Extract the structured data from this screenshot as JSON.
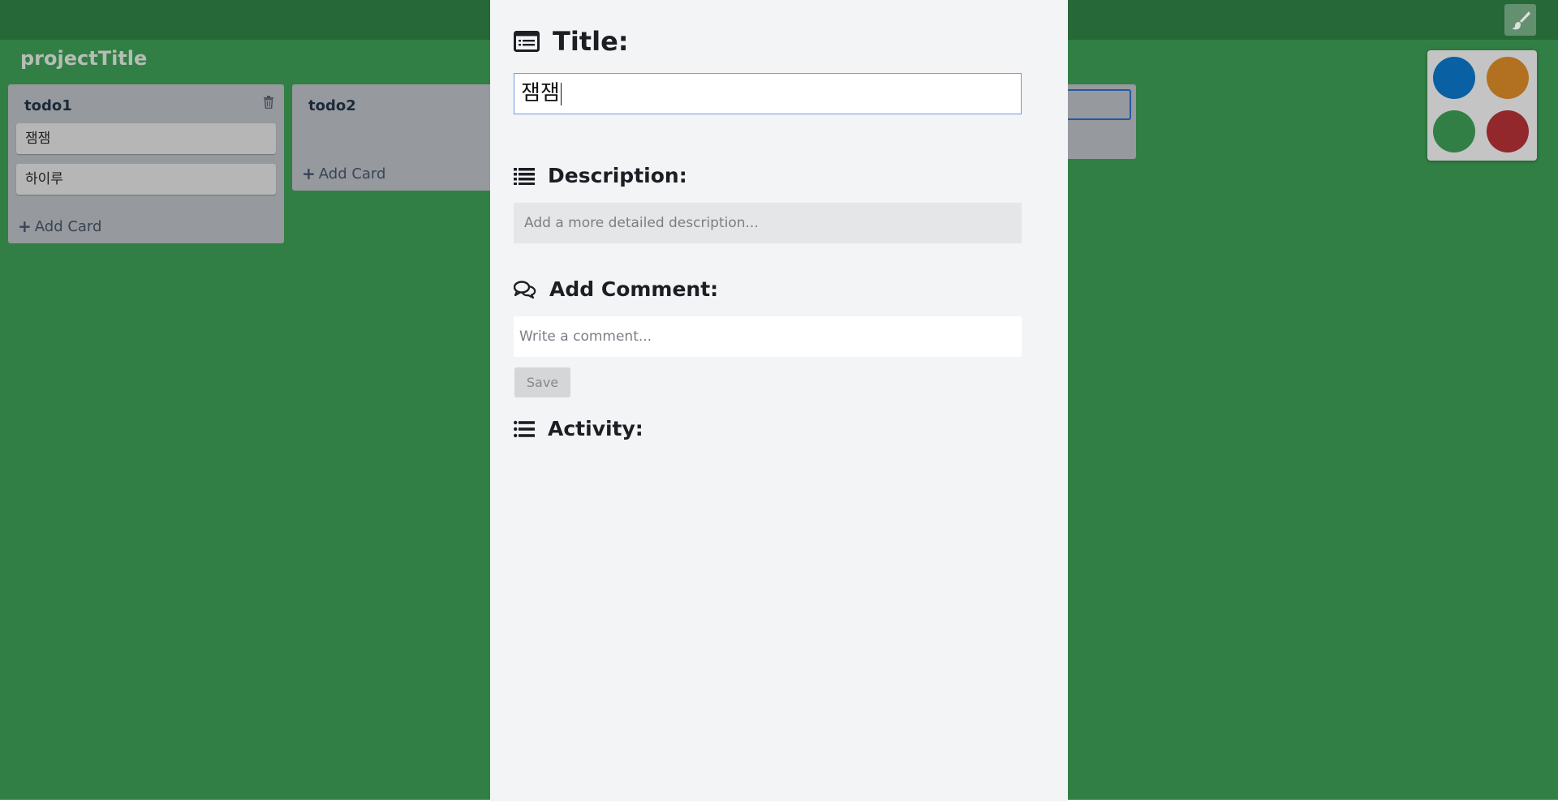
{
  "board": {
    "project_title": "projectTitle",
    "lists": [
      {
        "title": "todo1",
        "cards": [
          "잼잼",
          "하이루"
        ],
        "add_card_label": "Add Card"
      },
      {
        "title": "todo2",
        "cards": [],
        "add_card_label": "Add Card"
      }
    ]
  },
  "palette": {
    "colors": [
      "#0a68b0",
      "#bf7a24",
      "#35894a",
      "#9e2a30"
    ]
  },
  "modal": {
    "title_label": "Title:",
    "title_value": "잼잼",
    "description_label": "Description:",
    "description_placeholder": "Add a more detailed description...",
    "comment_label": "Add Comment:",
    "comment_placeholder": "Write a comment...",
    "save_label": "Save",
    "activity_label": "Activity:"
  },
  "colors": {
    "board_bg": "#35894a",
    "topbar_bg": "#2b703d",
    "modal_bg": "#f3f4f6"
  },
  "icons": {
    "brush": "paint-brush-icon",
    "trash": "trash-icon",
    "title": "credit-card-icon",
    "description": "list-icon",
    "comment": "comments-icon",
    "activity": "list-icon"
  }
}
